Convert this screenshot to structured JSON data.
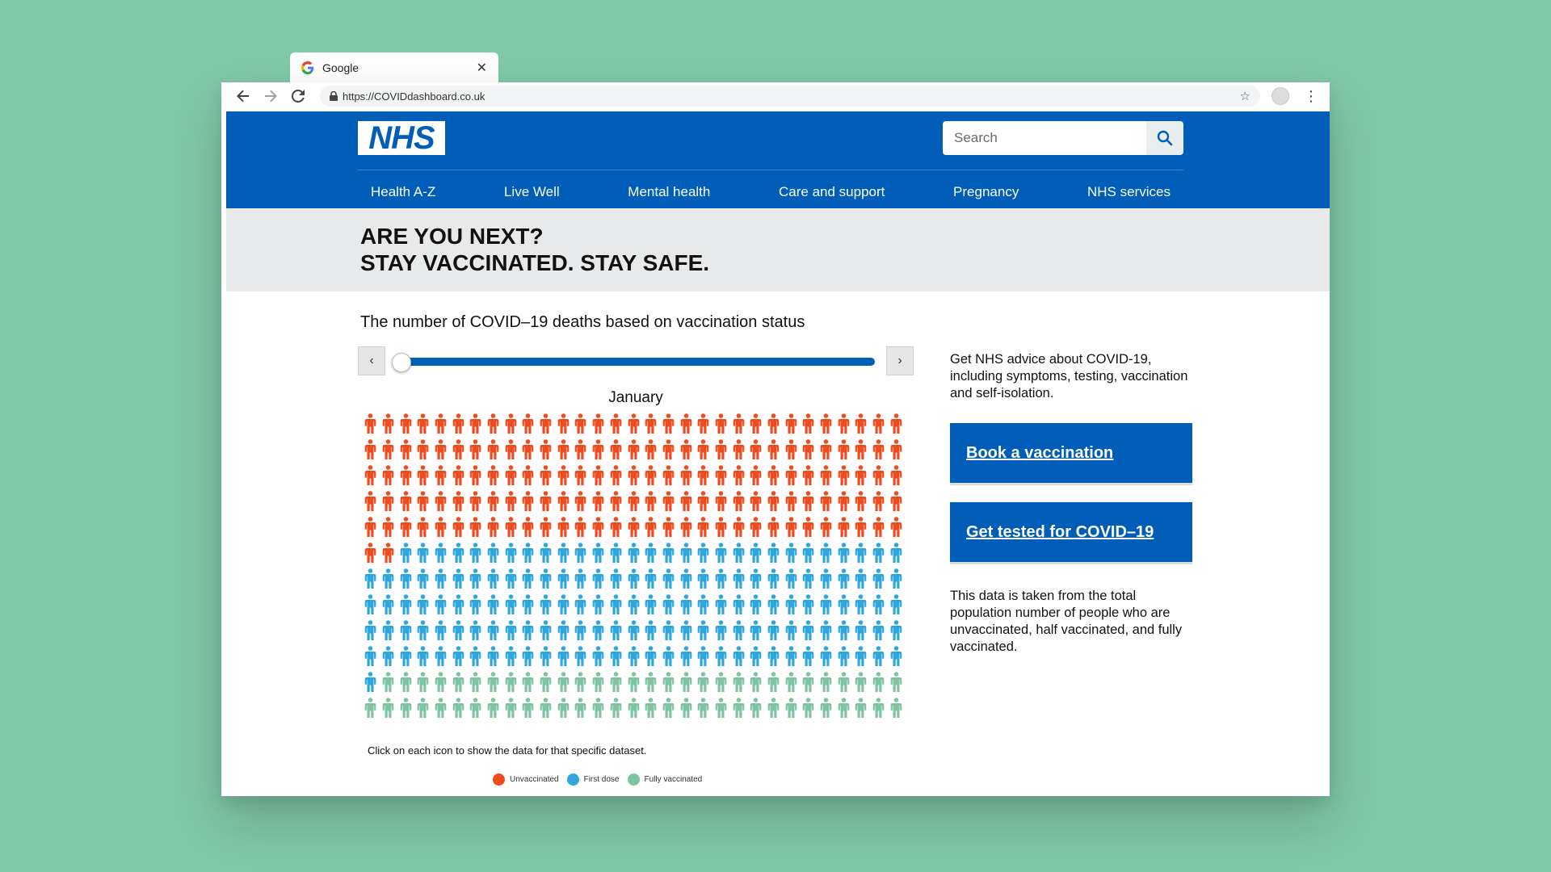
{
  "browser": {
    "tab_title": "Google",
    "url": "https://COVIDdashboard.co.uk"
  },
  "header": {
    "logo_text": "NHS",
    "search_placeholder": "Search",
    "nav": [
      "Health A-Z",
      "Live Well",
      "Mental health",
      "Care and support",
      "Pregnancy",
      "NHS services"
    ]
  },
  "banner": {
    "line1": "ARE YOU NEXT?",
    "line2": "STAY VACCINATED. STAY SAFE."
  },
  "chart_section": {
    "title": "The number of COVID–19 deaths based on vaccination status",
    "month": "January",
    "slider_position": 0,
    "prev_glyph": "‹",
    "next_glyph": "›",
    "caption": "Click on each icon to show the data for that specific dataset."
  },
  "chart_data": {
    "type": "pictogram",
    "rows": 12,
    "columns": 31,
    "categories": [
      "Unvaccinated",
      "First dose",
      "Fully vaccinated"
    ],
    "values": [
      157,
      154,
      61
    ],
    "colors": [
      "#f24a1c",
      "#2ea7de",
      "#7ec4a2"
    ]
  },
  "sidebar": {
    "intro": "Get NHS advice about COVID-19, including symptoms, testing, vaccination and self-isolation.",
    "cta_book": "Book a vaccination",
    "cta_test": "Get tested for COVID–19",
    "note": "This data is taken from the total population number of people who are unvaccinated, half vaccinated, and fully vaccinated."
  },
  "colors": {
    "nhs_blue": "#005eb8",
    "banner_bg": "#e8e9ea",
    "page_bg": "#80c8a8"
  }
}
